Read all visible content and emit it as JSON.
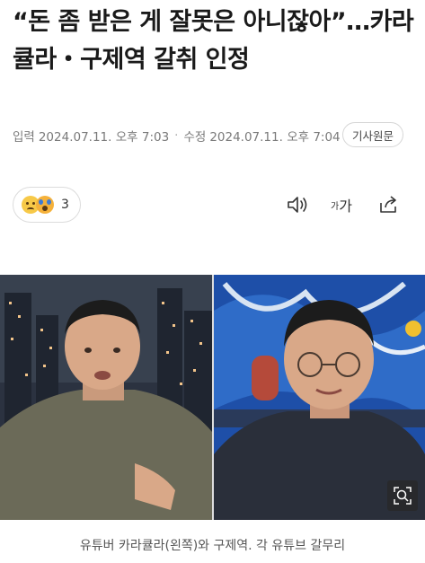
{
  "article": {
    "headline": "“돈 좀 받은 게 잘못은 아니잖아”…카라큘라・구제역 갈취 인정",
    "published_label": "입력",
    "published_time": "2024.07.11. 오후 7:03",
    "modified_label": "수정",
    "modified_time": "2024.07.11. 오후 7:04",
    "source_button": "기사원문"
  },
  "reactions": {
    "count": "3",
    "emojis": [
      "sad-face-icon",
      "shocked-face-icon"
    ]
  },
  "toolbar": {
    "font_small": "가",
    "font_large": "가",
    "icons": [
      "speaker-icon",
      "font-size-icon",
      "share-icon"
    ]
  },
  "photo": {
    "caption": "유튜버 카라큘라(왼쪽)와 구제역. 각 유튜브 갈무리",
    "colors": {
      "left_background": "#2b3240",
      "right_background": "#1e4fa8",
      "shirt_left": "#6b6a58",
      "shirt_right": "#2a2f3a",
      "skin": "#d9a888"
    }
  }
}
